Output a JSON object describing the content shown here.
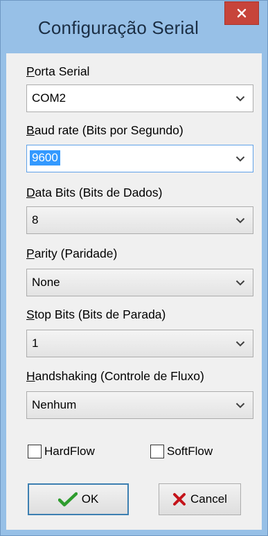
{
  "window": {
    "title": "Configuração Serial"
  },
  "fields": [
    {
      "label_u": "P",
      "label_rest": "orta Serial",
      "value": "COM2"
    },
    {
      "label_u": "B",
      "label_rest": "aud rate (Bits por Segundo)",
      "value": "9600"
    },
    {
      "label_u": "D",
      "label_rest": "ata Bits (Bits de Dados)",
      "value": "8"
    },
    {
      "label_u": "P",
      "label_rest": "arity (Paridade)",
      "value": "None"
    },
    {
      "label_u": "S",
      "label_rest": "top Bits (Bits de Parada)",
      "value": "1"
    },
    {
      "label_u": "H",
      "label_rest": "andshaking (Controle de Fluxo)",
      "value": "Nenhum"
    }
  ],
  "checkboxes": {
    "hardflow": "HardFlow",
    "softflow": "SoftFlow"
  },
  "buttons": {
    "ok": "OK",
    "cancel": "Cancel"
  },
  "icons": {
    "close": "close-icon",
    "combo_arrow": "chevron-down-icon",
    "ok": "checkmark-icon",
    "cancel": "x-icon"
  },
  "colors": {
    "frame": "#97c0e7",
    "close": "#c7443a",
    "checkmark": "#2e9c2e",
    "cancel_x": "#c4141b",
    "selection": "#3399ff"
  }
}
